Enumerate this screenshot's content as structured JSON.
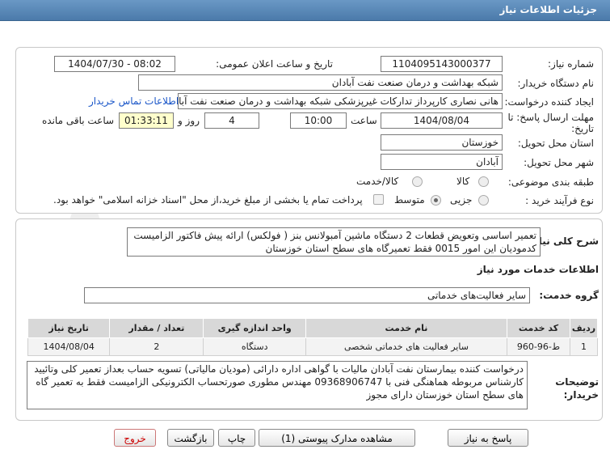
{
  "header": {
    "title": "جزئیات اطلاعات نیاز"
  },
  "form": {
    "need_number_label": "شماره نیاز:",
    "need_number": "1104095143000377",
    "announce_label": "تاریخ و ساعت اعلان عمومی:",
    "announce_value": "1404/07/30 - 08:02",
    "buyer_org_label": "نام دستگاه خریدار:",
    "buyer_org": "شبکه بهداشت و درمان صنعت نفت آبادان",
    "creator_label": "ایجاد کننده درخواست:",
    "creator": "هانی نصاری کارپرداز تدارکات غیرپزشکی شبکه بهداشت و درمان صنعت نفت آبادان",
    "contact_link": "اطلاعات تماس خریدار",
    "deadline_label": "مهلت ارسال پاسخ: تا تاریخ:",
    "deadline_date": "1404/08/04",
    "time_label": "ساعت",
    "deadline_time": "10:00",
    "days_value": "4",
    "days_label": "روز و",
    "remaining_time": "01:33:11",
    "remaining_label": "ساعت باقی مانده",
    "province_label": "استان محل تحویل:",
    "province": "خوزستان",
    "city_label": "شهر محل تحویل:",
    "city": "آبادان",
    "category_label": "طبقه بندی موضوعی:",
    "category_options": [
      "کالا",
      "کالا/خدمت"
    ],
    "process_label": "نوع فرآیند خرید :",
    "process_options": [
      "جزیی",
      "متوسط"
    ],
    "payment_note": "پرداخت تمام یا بخشی از مبلغ خرید،از محل \"اسناد خزانه اسلامی\" خواهد بود."
  },
  "description": {
    "label": "شرح کلی نیاز:",
    "text": "تعمیر اساسی وتعویض قطعات 2 دستگاه ماشین آمبولانس بنز ( فولکس) ارائه پیش فاکتور الزامیست کدمودیان این امور 0015 فقط تعمیرگاه های سطح استان خوزستان"
  },
  "services": {
    "section_title": "اطلاعات خدمات مورد نیاز",
    "group_label": "گروه خدمت:",
    "group_value": "سایر فعالیت‌های خدماتی",
    "columns": [
      "ردیف",
      "کد خدمت",
      "نام خدمت",
      "واحد اندازه گیری",
      "تعداد / مقدار",
      "تاریخ نیاز"
    ],
    "rows": [
      {
        "row": "1",
        "code": "ط-96-960",
        "name": "سایر فعالیت های خدماتی شخصی",
        "unit": "دستگاه",
        "qty": "2",
        "date": "1404/08/04"
      }
    ]
  },
  "buyer_notes": {
    "label": "توضیحات خریدار:",
    "text": "درخواست کننده بیمارستان نفت آبادان مالیات با گواهی اداره دارائی (مودیان مالیاتی) تسویه حساب بعداز تعمیر کلی وتائیید کارشناس مربوطه هماهنگی فنی با 09368906747 مهندس مطوری صورتحساب الکترونیکی الزامیست فقط به تعمیر گاه های سطح استان خوزستان دارای مجوز"
  },
  "buttons": {
    "reply": "پاسخ به نیاز",
    "attachments": "مشاهده مدارک پیوستی (1)",
    "print": "چاپ",
    "back": "بازگشت",
    "exit": "خروج"
  },
  "colors": {
    "header_bg": "#5a88b8",
    "link": "#1a56c8",
    "timer_bg": "#ffffcc",
    "exit_text": "#cc0000"
  }
}
